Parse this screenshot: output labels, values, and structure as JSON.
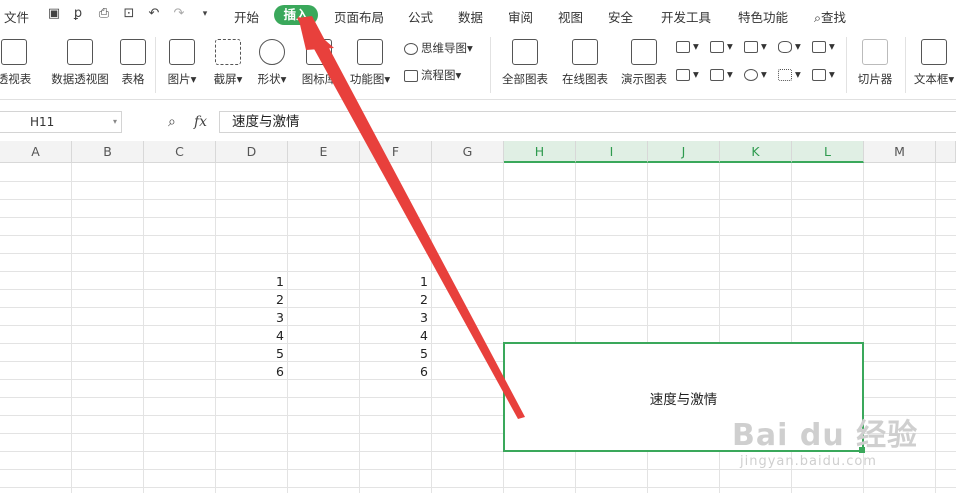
{
  "menubar": {
    "file": "文件",
    "tabs": [
      "开始",
      "插入",
      "页面布局",
      "公式",
      "数据",
      "审阅",
      "视图",
      "安全",
      "开发工具",
      "特色功能"
    ],
    "active_tab": "插入",
    "search_label": "查找"
  },
  "ribbon": {
    "pivot_table": "透视表",
    "pivot_chart": "数据透视图",
    "table": "表格",
    "picture": "图片",
    "screenshot": "截屏",
    "shapes": "形状",
    "icon_lib": "图标库",
    "func_chart": "功能图",
    "mindmap": "思维导图",
    "flowchart": "流程图",
    "all_charts": "全部图表",
    "online_charts": "在线图表",
    "demo_charts": "演示图表",
    "slicer": "切片器",
    "textbox": "文本框"
  },
  "formula_bar": {
    "name_box": "H11",
    "fx": "fx",
    "content": "速度与激情"
  },
  "columns": [
    "A",
    "B",
    "C",
    "D",
    "E",
    "F",
    "G",
    "H",
    "I",
    "J",
    "K",
    "L",
    "M"
  ],
  "cells": {
    "d_values": [
      "1",
      "2",
      "3",
      "4",
      "5",
      "6"
    ],
    "f_values": [
      "1",
      "2",
      "3",
      "4",
      "5",
      "6"
    ],
    "merged_text": "速度与激情"
  },
  "watermark": {
    "brand": "Bai du 经验",
    "url": "jingyan.baidu.com"
  },
  "colors": {
    "accent": "#3aa85b",
    "arrow": "#e8403c"
  }
}
